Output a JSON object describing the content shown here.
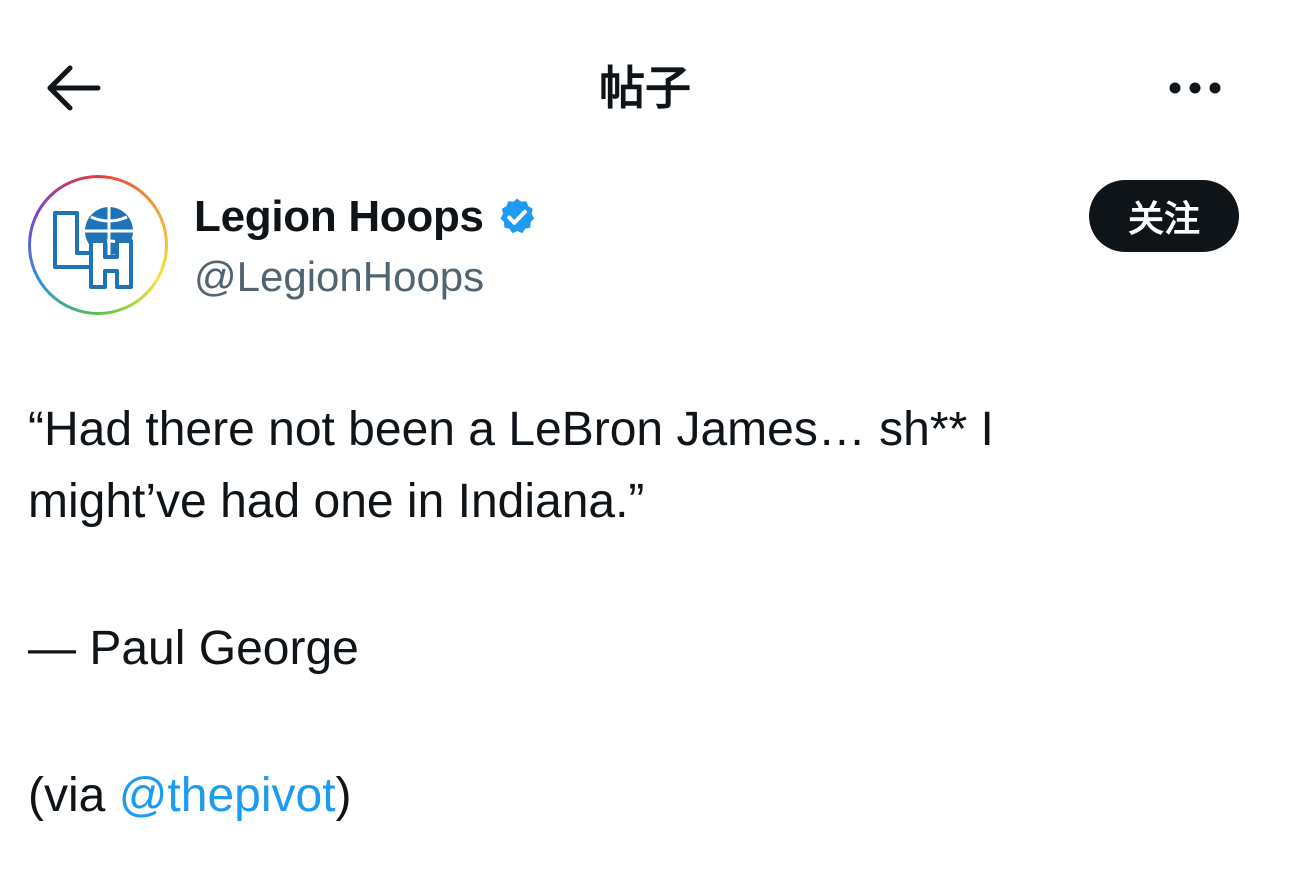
{
  "header": {
    "title": "帖子",
    "back_icon": "arrow-left-icon",
    "more_icon": "more-horizontal-icon"
  },
  "author": {
    "display_name": "Legion Hoops",
    "handle": "@LegionHoops",
    "verified_icon": "verified-badge-icon",
    "avatar_text": "LH",
    "follow_label": "关注"
  },
  "tweet": {
    "line1": "“Had there not been a LeBron James… sh** I",
    "line2": "might’ve had one in Indiana.”",
    "attribution": "— Paul George",
    "via_prefix": "(via ",
    "mention": "@thepivot",
    "via_suffix": ")"
  },
  "colors": {
    "text": "#0f1419",
    "secondary": "#536471",
    "link": "#1d9bf0",
    "verified": "#1d9bf0",
    "follow_bg": "#0f1419"
  }
}
